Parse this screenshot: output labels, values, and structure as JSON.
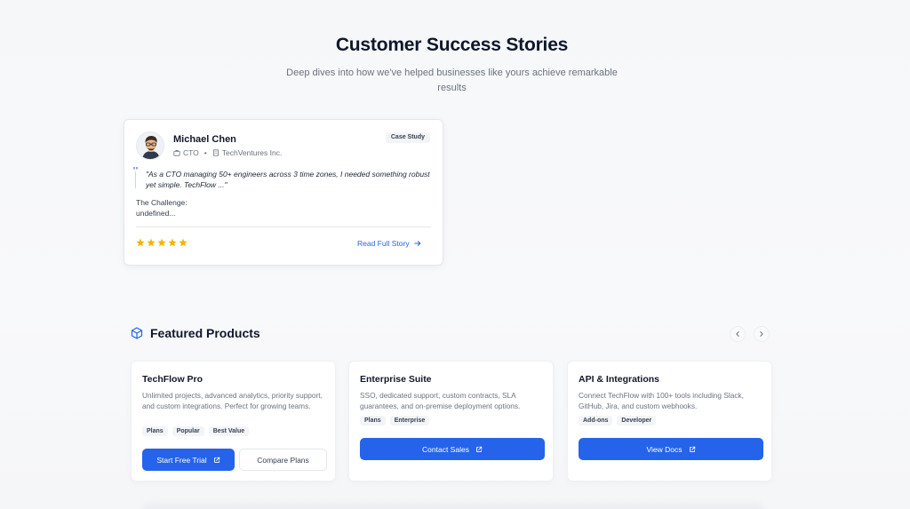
{
  "hero": {
    "title": "Customer Success Stories",
    "subtitle": "Deep dives into how we've helped businesses like yours achieve remarkable results"
  },
  "story": {
    "name": "Michael Chen",
    "role": "CTO",
    "company": "TechVentures Inc.",
    "badge": "Case Study",
    "quote": "\"As a CTO managing 50+ engineers across 3 time zones, I needed something robust yet simple. TechFlow ...\"",
    "challenge_label": "The Challenge:",
    "challenge_value": "undefined...",
    "rating": 5,
    "read_more": "Read Full Story",
    "star_color": "#f5b400"
  },
  "featured": {
    "title": "Featured Products",
    "prev_icon": "chevron-left-icon",
    "next_icon": "chevron-right-icon",
    "products": [
      {
        "title": "TechFlow Pro",
        "description": "Unlimited projects, advanced analytics, priority support, and custom integrations. Perfect for growing teams.",
        "tags": [
          "Plans",
          "Popular",
          "Best Value"
        ],
        "primary_label": "Start Free Trial",
        "secondary_label": "Compare Plans"
      },
      {
        "title": "Enterprise Suite",
        "description": "SSO, dedicated support, custom contracts, SLA guarantees, and on-premise deployment options.",
        "tags": [
          "Plans",
          "Enterprise"
        ],
        "primary_label": "Contact Sales"
      },
      {
        "title": "API & Integrations",
        "description": "Connect TechFlow with 100+ tools including Slack, GitHub, Jira, and custom webhooks.",
        "tags": [
          "Add-ons",
          "Developer"
        ],
        "primary_label": "View Docs"
      }
    ]
  },
  "colors": {
    "accent": "#2563eb",
    "text": "#111827",
    "muted": "#6b7280"
  }
}
